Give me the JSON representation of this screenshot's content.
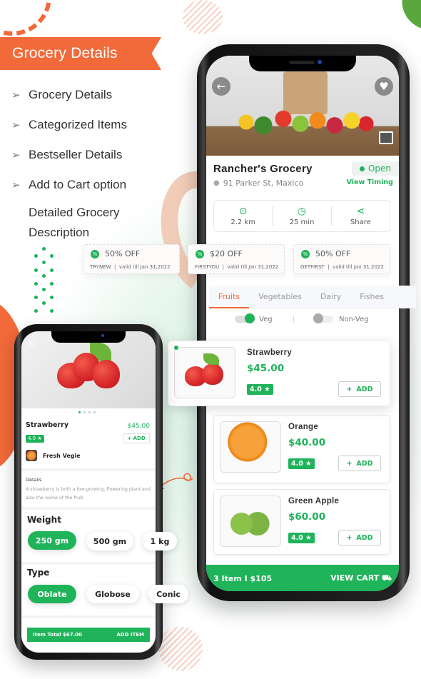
{
  "banner": {
    "title": "Grocery Details"
  },
  "features": [
    {
      "label": "Grocery Details",
      "arrow": true
    },
    {
      "label": "Categorized Items",
      "arrow": true
    },
    {
      "label": "Bestseller Details",
      "arrow": true
    },
    {
      "label": "Add to Cart option",
      "arrow": true
    },
    {
      "label": "Detailed Grocery",
      "arrow": false
    },
    {
      "label": "Description",
      "arrow": false
    }
  ],
  "icons": {
    "arrow": "➢",
    "back": "←",
    "heart": "♥",
    "pin": "📍",
    "clock": "◷",
    "share": "⋖",
    "cart": "🛒",
    "close": "✕",
    "star": "★",
    "plus": "+"
  },
  "colors": {
    "accent_orange": "#f26a3a",
    "accent_green": "#1fb35a"
  },
  "store": {
    "name": "Rancher's Grocery",
    "address": "91 Parker St, Maxico",
    "status": "Open",
    "view_timing": "View Timing",
    "stats": [
      {
        "icon": "location-pin-icon",
        "label": "2.2 km"
      },
      {
        "icon": "clock-icon",
        "label": "25 min"
      },
      {
        "icon": "share-icon",
        "label": "Share"
      }
    ]
  },
  "coupons": [
    {
      "title": "50% OFF",
      "code": "TRYNEW",
      "validity": "valid till Jan 31,2022"
    },
    {
      "title": "$20 OFF",
      "code": "FIRSTYOU",
      "validity": "valid till Jan 31,2022"
    },
    {
      "title": "50% OFF",
      "code": "GETFIRST",
      "validity": "valid till Jan 31,2022"
    }
  ],
  "tabs": [
    {
      "label": "Fruits",
      "active": true
    },
    {
      "label": "Vegetables",
      "active": false
    },
    {
      "label": "Dairy",
      "active": false
    },
    {
      "label": "Fishes",
      "active": false
    }
  ],
  "filters": {
    "veg": "Veg",
    "nonveg": "Non-Veg",
    "separator": "|"
  },
  "items": [
    {
      "name": "Strawberry",
      "price": "$45.00",
      "rating": "4.0",
      "add": "ADD"
    },
    {
      "name": "Orange",
      "price": "$40.00",
      "rating": "4.0",
      "add": "ADD"
    },
    {
      "name": "Green Apple",
      "price": "$60.00",
      "rating": "4.0",
      "add": "ADD"
    }
  ],
  "cart": {
    "summary": "3 Item  I  $105",
    "action": "VIEW CART"
  },
  "detail": {
    "name": "Strawberry",
    "price": "$45.00",
    "rating": "4.0",
    "add": "+ ADD",
    "seller": "Fresh Vegie",
    "details_heading": "Details",
    "details_text": "A strawberry is both a low-growing, flowering plant and also the name of the fruit.",
    "weight_heading": "Weight",
    "weights": [
      {
        "label": "250 gm",
        "selected": true
      },
      {
        "label": "500 gm",
        "selected": false
      },
      {
        "label": "1 kg",
        "selected": false
      }
    ],
    "type_heading": "Type",
    "types": [
      {
        "label": "Oblate",
        "selected": true
      },
      {
        "label": "Globose",
        "selected": false
      },
      {
        "label": "Conic",
        "selected": false
      }
    ],
    "total": "Item Total $67.00",
    "add_item": "ADD ITEM"
  }
}
